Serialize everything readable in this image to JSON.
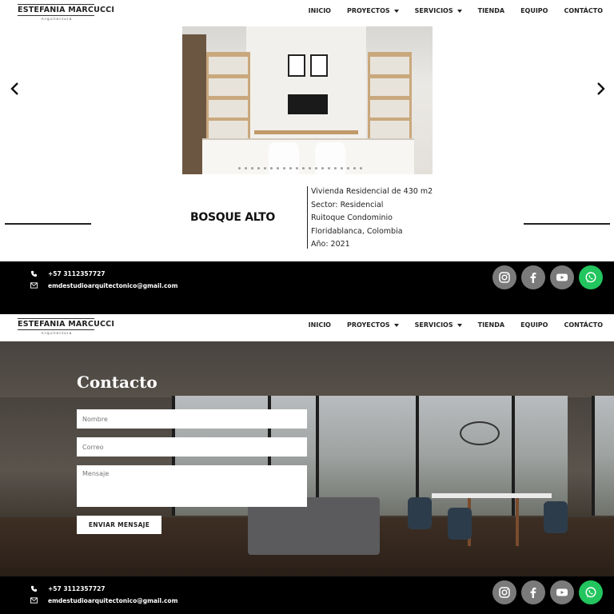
{
  "brand": {
    "name": "ESTEFANIA MARCUCCI",
    "subtitle": "Arquitectura"
  },
  "nav": {
    "items": [
      {
        "label": "INICIO",
        "dropdown": false
      },
      {
        "label": "PROYECTOS",
        "dropdown": true
      },
      {
        "label": "SERVICIOS",
        "dropdown": true
      },
      {
        "label": "TIENDA",
        "dropdown": false
      },
      {
        "label": "EQUIPO",
        "dropdown": false
      },
      {
        "label": "CONTÁCTO",
        "dropdown": false
      }
    ]
  },
  "project": {
    "title": "BOSQUE ALTO",
    "details": [
      "Vivienda Residencial de 430 m2",
      "Sector:  Residencial",
      "Ruitoque Condominio",
      "Floridablanca, Colombia",
      "Año: 2021"
    ],
    "slider_icons": [
      "chevron-left-icon",
      "chevron-right-icon"
    ]
  },
  "footer": {
    "phone": "+57 3112357727",
    "email": "emdestudioarquitectonico@gmail.com",
    "socials": [
      {
        "icon": "instagram-icon",
        "color": "#7a7a7a"
      },
      {
        "icon": "facebook-icon",
        "color": "#7a7a7a"
      },
      {
        "icon": "youtube-icon",
        "color": "#7a7a7a"
      },
      {
        "icon": "whatsapp-icon",
        "color": "#22c55e"
      }
    ]
  },
  "contact": {
    "title": "Contacto",
    "name_placeholder": "Nombre",
    "email_placeholder": "Correo",
    "message_placeholder": "Mensaje",
    "submit_label": "ENVIAR MENSAJE"
  }
}
